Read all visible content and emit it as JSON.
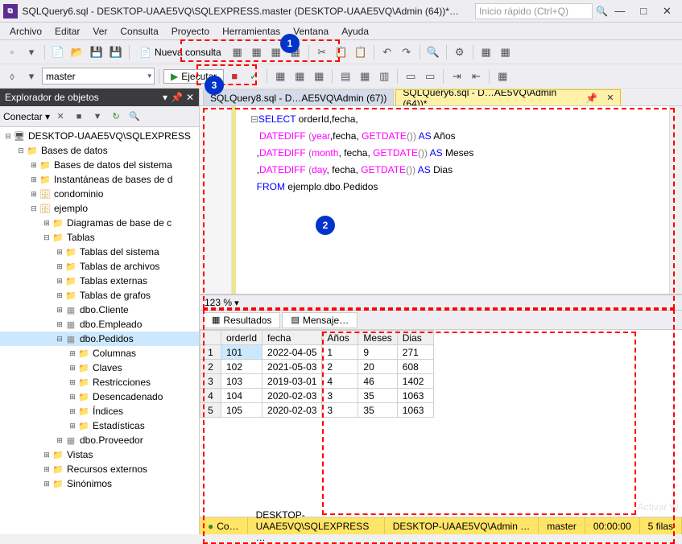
{
  "window": {
    "title": "SQLQuery6.sql - DESKTOP-UAAE5VQ\\SQLEXPRESS.master (DESKTOP-UAAE5VQ\\Admin (64))*…",
    "quick_launch_placeholder": "Inicio rápido (Ctrl+Q)"
  },
  "menu": {
    "items": [
      "Archivo",
      "Editar",
      "Ver",
      "Consulta",
      "Proyecto",
      "Herramientas",
      "Ventana",
      "Ayuda"
    ]
  },
  "toolbar1": {
    "new_query_label": "Nueva consulta"
  },
  "toolbar2": {
    "db_combo": "master",
    "execute_label": "Ejecutar"
  },
  "sidebar": {
    "title": "Explorador de objetos",
    "connect_label": "Conectar",
    "nodes": [
      {
        "depth": 0,
        "exp": "⊟",
        "icon": "server",
        "label": "DESKTOP-UAAE5VQ\\SQLEXPRESS"
      },
      {
        "depth": 1,
        "exp": "⊟",
        "icon": "folder",
        "label": "Bases de datos"
      },
      {
        "depth": 2,
        "exp": "⊞",
        "icon": "folder",
        "label": "Bases de datos del sistema"
      },
      {
        "depth": 2,
        "exp": "⊞",
        "icon": "folder",
        "label": "Instantáneas de bases de d"
      },
      {
        "depth": 2,
        "exp": "⊞",
        "icon": "db",
        "label": "condominio"
      },
      {
        "depth": 2,
        "exp": "⊟",
        "icon": "db",
        "label": "ejemplo"
      },
      {
        "depth": 3,
        "exp": "⊞",
        "icon": "folder",
        "label": "Diagramas de base de c"
      },
      {
        "depth": 3,
        "exp": "⊟",
        "icon": "folder",
        "label": "Tablas"
      },
      {
        "depth": 4,
        "exp": "⊞",
        "icon": "folder",
        "label": "Tablas del sistema"
      },
      {
        "depth": 4,
        "exp": "⊞",
        "icon": "folder",
        "label": "Tablas de archivos"
      },
      {
        "depth": 4,
        "exp": "⊞",
        "icon": "folder",
        "label": "Tablas externas"
      },
      {
        "depth": 4,
        "exp": "⊞",
        "icon": "folder",
        "label": "Tablas de grafos"
      },
      {
        "depth": 4,
        "exp": "⊞",
        "icon": "table",
        "label": "dbo.Cliente"
      },
      {
        "depth": 4,
        "exp": "⊞",
        "icon": "table",
        "label": "dbo.Empleado"
      },
      {
        "depth": 4,
        "exp": "⊟",
        "icon": "table",
        "label": "dbo.Pedidos",
        "sel": true
      },
      {
        "depth": 5,
        "exp": "⊞",
        "icon": "folder",
        "label": "Columnas"
      },
      {
        "depth": 5,
        "exp": "⊞",
        "icon": "folder",
        "label": "Claves"
      },
      {
        "depth": 5,
        "exp": "⊞",
        "icon": "folder",
        "label": "Restricciones"
      },
      {
        "depth": 5,
        "exp": "⊞",
        "icon": "folder",
        "label": "Desencadenado"
      },
      {
        "depth": 5,
        "exp": "⊞",
        "icon": "folder",
        "label": "Índices"
      },
      {
        "depth": 5,
        "exp": "⊞",
        "icon": "folder",
        "label": "Estadísticas"
      },
      {
        "depth": 4,
        "exp": "⊞",
        "icon": "table",
        "label": "dbo.Proveedor"
      },
      {
        "depth": 3,
        "exp": "⊞",
        "icon": "folder",
        "label": "Vistas"
      },
      {
        "depth": 3,
        "exp": "⊞",
        "icon": "folder",
        "label": "Recursos externos"
      },
      {
        "depth": 3,
        "exp": "⊞",
        "icon": "folder",
        "label": "Sinónimos"
      }
    ]
  },
  "tabs": {
    "items": [
      {
        "label": "SQLQuery8.sql - D…AE5VQ\\Admin (67))",
        "active": false
      },
      {
        "label": "SQLQuery6.sql - D…AE5VQ\\Admin (64))*",
        "active": true
      }
    ]
  },
  "sql": {
    "lines": [
      {
        "t": "SELECT",
        "k": "kw"
      },
      {
        "t": " orderId"
      },
      {
        "t": ","
      },
      {
        "t": "fecha"
      },
      {
        "t": ","
      },
      {
        "nl": 1
      },
      {
        "t": " "
      },
      {
        "t": "DATEDIFF",
        "k": "fn"
      },
      {
        "t": " ",
        "k": "gray"
      },
      {
        "t": "(",
        "k": "gray"
      },
      {
        "t": "year",
        "k": "fn"
      },
      {
        "t": ","
      },
      {
        "t": "fecha"
      },
      {
        "t": ","
      },
      {
        "t": " "
      },
      {
        "t": "GETDATE",
        "k": "fn"
      },
      {
        "t": "()",
        "k": "gray"
      },
      {
        "t": ")",
        "k": "gray"
      },
      {
        "t": " "
      },
      {
        "t": "AS",
        "k": "kw"
      },
      {
        "t": " Años"
      },
      {
        "nl": 1
      },
      {
        "t": ","
      },
      {
        "t": "DATEDIFF",
        "k": "fn"
      },
      {
        "t": " ",
        "k": "gray"
      },
      {
        "t": "(",
        "k": "gray"
      },
      {
        "t": "month",
        "k": "fn"
      },
      {
        "t": ","
      },
      {
        "t": " fecha"
      },
      {
        "t": ","
      },
      {
        "t": " "
      },
      {
        "t": "GETDATE",
        "k": "fn"
      },
      {
        "t": "()",
        "k": "gray"
      },
      {
        "t": ")",
        "k": "gray"
      },
      {
        "t": " "
      },
      {
        "t": "AS",
        "k": "kw"
      },
      {
        "t": " Meses"
      },
      {
        "nl": 1
      },
      {
        "t": ","
      },
      {
        "t": "DATEDIFF",
        "k": "fn"
      },
      {
        "t": " ",
        "k": "gray"
      },
      {
        "t": "(",
        "k": "gray"
      },
      {
        "t": "day",
        "k": "fn"
      },
      {
        "t": ","
      },
      {
        "t": " fecha"
      },
      {
        "t": ","
      },
      {
        "t": " "
      },
      {
        "t": "GETDATE",
        "k": "fn"
      },
      {
        "t": "()",
        "k": "gray"
      },
      {
        "t": ")",
        "k": "gray"
      },
      {
        "t": " "
      },
      {
        "t": "AS",
        "k": "kw"
      },
      {
        "t": " Dias"
      },
      {
        "nl": 1
      },
      {
        "t": "FROM",
        "k": "kw"
      },
      {
        "t": " ejemplo"
      },
      {
        "t": ".",
        "k": "gray"
      },
      {
        "t": "dbo"
      },
      {
        "t": ".",
        "k": "gray"
      },
      {
        "t": "Pedidos"
      }
    ]
  },
  "zoom": {
    "value": "123 %"
  },
  "results_tabs": {
    "results": "Resultados",
    "messages": "Mensaje…"
  },
  "grid": {
    "columns": [
      "orderId",
      "fecha",
      "Años",
      "Meses",
      "Dias"
    ],
    "rows": [
      {
        "n": "1",
        "cells": [
          "101",
          "2022-04-05",
          "1",
          "9",
          "271"
        ],
        "sel": 0
      },
      {
        "n": "2",
        "cells": [
          "102",
          "2021-05-03",
          "2",
          "20",
          "608"
        ]
      },
      {
        "n": "3",
        "cells": [
          "103",
          "2019-03-01",
          "4",
          "46",
          "1402"
        ]
      },
      {
        "n": "4",
        "cells": [
          "104",
          "2020-02-03",
          "3",
          "35",
          "1063"
        ]
      },
      {
        "n": "5",
        "cells": [
          "105",
          "2020-02-03",
          "3",
          "35",
          "1063"
        ]
      }
    ]
  },
  "status": {
    "state": "Co…",
    "server": "DESKTOP-UAAE5VQ\\SQLEXPRESS …",
    "user": "DESKTOP-UAAE5VQ\\Admin …",
    "db": "master",
    "time": "00:00:00",
    "rows": "5 filas"
  },
  "annotations": {
    "c1": "1",
    "c2": "2",
    "c3": "3"
  },
  "watermark": "Activar W"
}
